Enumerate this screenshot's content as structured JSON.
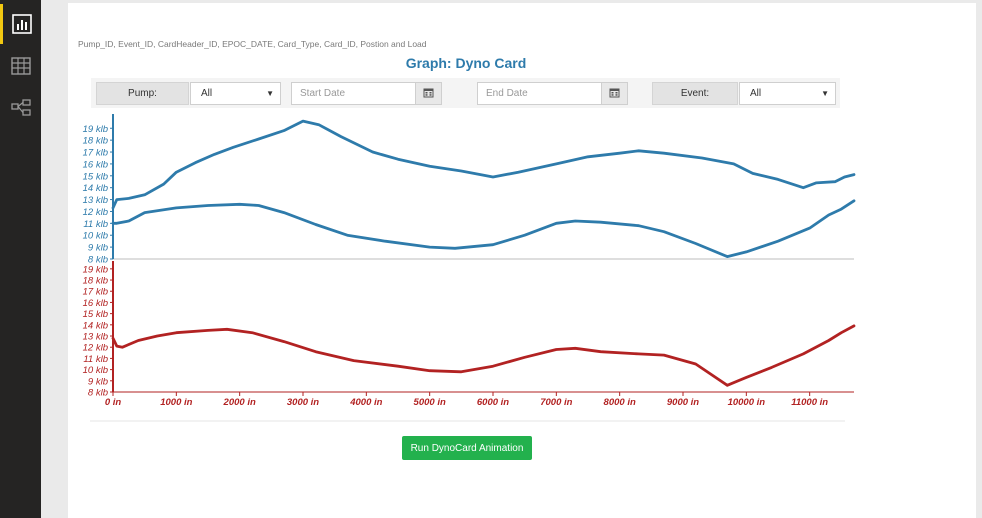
{
  "sidebar": {
    "items": [
      {
        "icon": "report-icon",
        "active": true
      },
      {
        "icon": "table-icon",
        "active": false
      },
      {
        "icon": "model-icon",
        "active": false
      }
    ]
  },
  "fields_text": "Pump_ID, Event_ID, CardHeader_ID, EPOC_DATE, Card_Type, Card_ID, Postion and Load",
  "filters": {
    "pump_label": "Pump:",
    "pump_value": "All",
    "start_placeholder": "Start Date",
    "end_placeholder": "End Date",
    "event_label": "Event:",
    "event_value": "All"
  },
  "run_button_label": "Run DynoCard Animation",
  "chart_data": {
    "type": "line",
    "title": "Graph: Dyno Card",
    "colors": {
      "surface": "#2e7bab",
      "pump": "#b22222"
    },
    "x_axis": {
      "unit": "in",
      "ticks": [
        0,
        1000,
        2000,
        3000,
        4000,
        5000,
        6000,
        7000,
        8000,
        9000,
        10000,
        11000
      ],
      "tick_labels": [
        "0 in",
        "1000 in",
        "2000 in",
        "3000 in",
        "4000 in",
        "5000 in",
        "6000 in",
        "7000 in",
        "8000 in",
        "9000 in",
        "10000 in",
        "11000 in"
      ],
      "range": [
        0,
        11700
      ]
    },
    "panels": [
      {
        "name": "surface card",
        "color": "#2e7bab",
        "y_ticks": [
          8,
          9,
          10,
          11,
          12,
          13,
          14,
          15,
          16,
          17,
          18,
          19
        ],
        "y_tick_labels": [
          "8 klb",
          "9 klb",
          "10 klb",
          "11 klb",
          "12 klb",
          "13 klb",
          "14 klb",
          "15 klb",
          "16 klb",
          "17 klb",
          "18 klb",
          "19 klb"
        ],
        "ylim": [
          8,
          20.2
        ],
        "series": [
          {
            "points": [
              [
                0,
                12.3
              ],
              [
                60,
                13.0
              ],
              [
                250,
                13.1
              ],
              [
                500,
                13.4
              ],
              [
                800,
                14.3
              ],
              [
                1000,
                15.3
              ],
              [
                1300,
                16.1
              ],
              [
                1600,
                16.8
              ],
              [
                1900,
                17.4
              ],
              [
                2300,
                18.1
              ],
              [
                2700,
                18.8
              ],
              [
                3000,
                19.6
              ],
              [
                3250,
                19.3
              ],
              [
                3600,
                18.3
              ],
              [
                4100,
                17.0
              ],
              [
                4500,
                16.4
              ],
              [
                5000,
                15.8
              ],
              [
                5500,
                15.4
              ],
              [
                6000,
                14.9
              ],
              [
                6400,
                15.3
              ],
              [
                7000,
                16.0
              ],
              [
                7500,
                16.6
              ],
              [
                8000,
                16.9
              ],
              [
                8300,
                17.1
              ],
              [
                8700,
                16.9
              ],
              [
                9300,
                16.5
              ],
              [
                9800,
                16.0
              ],
              [
                10100,
                15.2
              ],
              [
                10500,
                14.7
              ],
              [
                10900,
                14.0
              ],
              [
                11100,
                14.4
              ],
              [
                11400,
                14.5
              ],
              [
                11550,
                14.9
              ],
              [
                11700,
                15.1
              ]
            ]
          },
          {
            "points": [
              [
                0,
                11.0
              ],
              [
                60,
                11.0
              ],
              [
                250,
                11.2
              ],
              [
                500,
                11.9
              ],
              [
                1000,
                12.3
              ],
              [
                1500,
                12.5
              ],
              [
                2000,
                12.6
              ],
              [
                2300,
                12.5
              ],
              [
                2700,
                11.9
              ],
              [
                3200,
                10.9
              ],
              [
                3700,
                10.0
              ],
              [
                4300,
                9.5
              ],
              [
                5000,
                9.0
              ],
              [
                5400,
                8.9
              ],
              [
                6000,
                9.2
              ],
              [
                6500,
                10.0
              ],
              [
                7000,
                11.0
              ],
              [
                7300,
                11.2
              ],
              [
                7700,
                11.1
              ],
              [
                8300,
                10.8
              ],
              [
                8700,
                10.3
              ],
              [
                9200,
                9.3
              ],
              [
                9700,
                8.2
              ],
              [
                10000,
                8.6
              ],
              [
                10500,
                9.5
              ],
              [
                11000,
                10.6
              ],
              [
                11300,
                11.7
              ],
              [
                11500,
                12.2
              ],
              [
                11700,
                12.9
              ]
            ]
          }
        ]
      },
      {
        "name": "pump card",
        "color": "#b22222",
        "y_ticks": [
          8,
          9,
          10,
          11,
          12,
          13,
          14,
          15,
          16,
          17,
          18,
          19
        ],
        "y_tick_labels": [
          "8 klb",
          "9 klb",
          "10 klb",
          "11 klb",
          "12 klb",
          "13 klb",
          "14 klb",
          "15 klb",
          "16 klb",
          "17 klb",
          "18 klb",
          "19 klb"
        ],
        "ylim": [
          8,
          19.7
        ],
        "series": [
          {
            "points": [
              [
                0,
                12.8
              ],
              [
                60,
                12.1
              ],
              [
                150,
                12.0
              ],
              [
                400,
                12.6
              ],
              [
                700,
                13.0
              ],
              [
                1000,
                13.3
              ],
              [
                1500,
                13.5
              ],
              [
                1800,
                13.6
              ],
              [
                2200,
                13.3
              ],
              [
                2700,
                12.5
              ],
              [
                3200,
                11.6
              ],
              [
                3800,
                10.8
              ],
              [
                4500,
                10.3
              ],
              [
                5000,
                9.9
              ],
              [
                5500,
                9.8
              ],
              [
                6000,
                10.3
              ],
              [
                6500,
                11.1
              ],
              [
                7000,
                11.8
              ],
              [
                7300,
                11.9
              ],
              [
                7700,
                11.6
              ],
              [
                8300,
                11.4
              ],
              [
                8700,
                11.3
              ],
              [
                9200,
                10.5
              ],
              [
                9700,
                8.6
              ],
              [
                10000,
                9.3
              ],
              [
                10400,
                10.2
              ],
              [
                10900,
                11.4
              ],
              [
                11300,
                12.6
              ],
              [
                11500,
                13.3
              ],
              [
                11700,
                13.9
              ]
            ]
          }
        ]
      }
    ]
  }
}
